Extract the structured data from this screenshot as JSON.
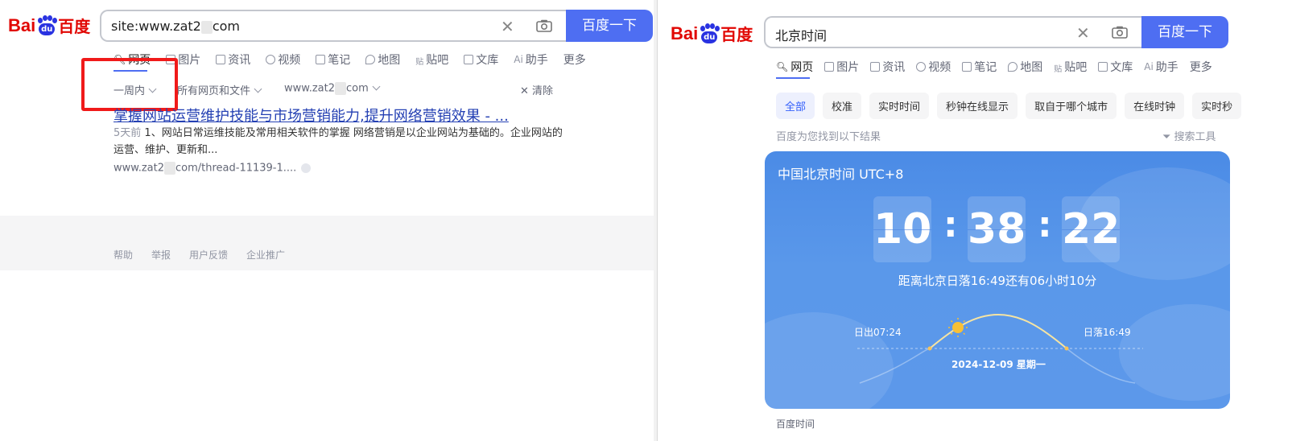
{
  "left": {
    "logo": {
      "bai": "Bai",
      "du": "du",
      "cn": "百度"
    },
    "search": {
      "value_prefix": "site:www.zat2",
      "value_suffix": "com",
      "button": "百度一下"
    },
    "tabs": [
      {
        "label": "网页",
        "icon": "search-icon"
      },
      {
        "label": "图片",
        "icon": "image-icon"
      },
      {
        "label": "资讯",
        "icon": "news-icon"
      },
      {
        "label": "视频",
        "icon": "video-icon"
      },
      {
        "label": "笔记",
        "icon": "note-icon"
      },
      {
        "label": "地图",
        "icon": "map-icon"
      },
      {
        "label": "贴吧",
        "icon": "tieba-icon"
      },
      {
        "label": "文库",
        "icon": "doc-icon"
      },
      {
        "label": "助手",
        "icon": "ai-icon"
      },
      {
        "label": "更多",
        "icon": ""
      }
    ],
    "filters": {
      "time": "一周内",
      "type": "所有网页和文件",
      "site_prefix": "www.zat2",
      "site_suffix": "com",
      "clear": "清除"
    },
    "result": {
      "title": "掌握网站运营维护技能与市场营销能力,提升网络营销效果 - ...",
      "date": "5天前",
      "abstract": "1、网站日常运维技能及常用相关软件的掌握 网络营销是以企业网站为基础的。企业网站的运营、维护、更新和...",
      "url_prefix": "www.zat2",
      "url_suffix": "com/thread-11139-1...."
    },
    "footer": [
      "帮助",
      "举报",
      "用户反馈",
      "企业推广"
    ]
  },
  "right": {
    "logo": {
      "bai": "Bai",
      "du": "du",
      "cn": "百度"
    },
    "search": {
      "value": "北京时间",
      "button": "百度一下"
    },
    "tabs": [
      {
        "label": "网页",
        "icon": "search-icon"
      },
      {
        "label": "图片",
        "icon": "image-icon"
      },
      {
        "label": "资讯",
        "icon": "news-icon"
      },
      {
        "label": "视频",
        "icon": "video-icon"
      },
      {
        "label": "笔记",
        "icon": "note-icon"
      },
      {
        "label": "地图",
        "icon": "map-icon"
      },
      {
        "label": "贴吧",
        "icon": "tieba-icon"
      },
      {
        "label": "文库",
        "icon": "doc-icon"
      },
      {
        "label": "助手",
        "icon": "ai-icon"
      },
      {
        "label": "更多",
        "icon": ""
      }
    ],
    "chips": [
      "全部",
      "校准",
      "实时时间",
      "秒钟在线显示",
      "取自于哪个城市",
      "在线时钟",
      "实时秒"
    ],
    "found": "百度为您找到以下结果",
    "tools": "搜索工具",
    "clock": {
      "title": "中国北京时间 UTC+8",
      "hh": "10",
      "mm": "38",
      "ss": "22",
      "sunset_text": "距离北京日落16:49还有06小时10分",
      "sunrise": "日出07:24",
      "sunset": "日落16:49",
      "date": "2024-12-09   星期一"
    },
    "caption": "百度时间"
  },
  "colors": {
    "brand_blue": "#4e6ef2",
    "logo_red": "#e10602",
    "link": "#2440b3",
    "highlight_box": "#f01a1a"
  }
}
